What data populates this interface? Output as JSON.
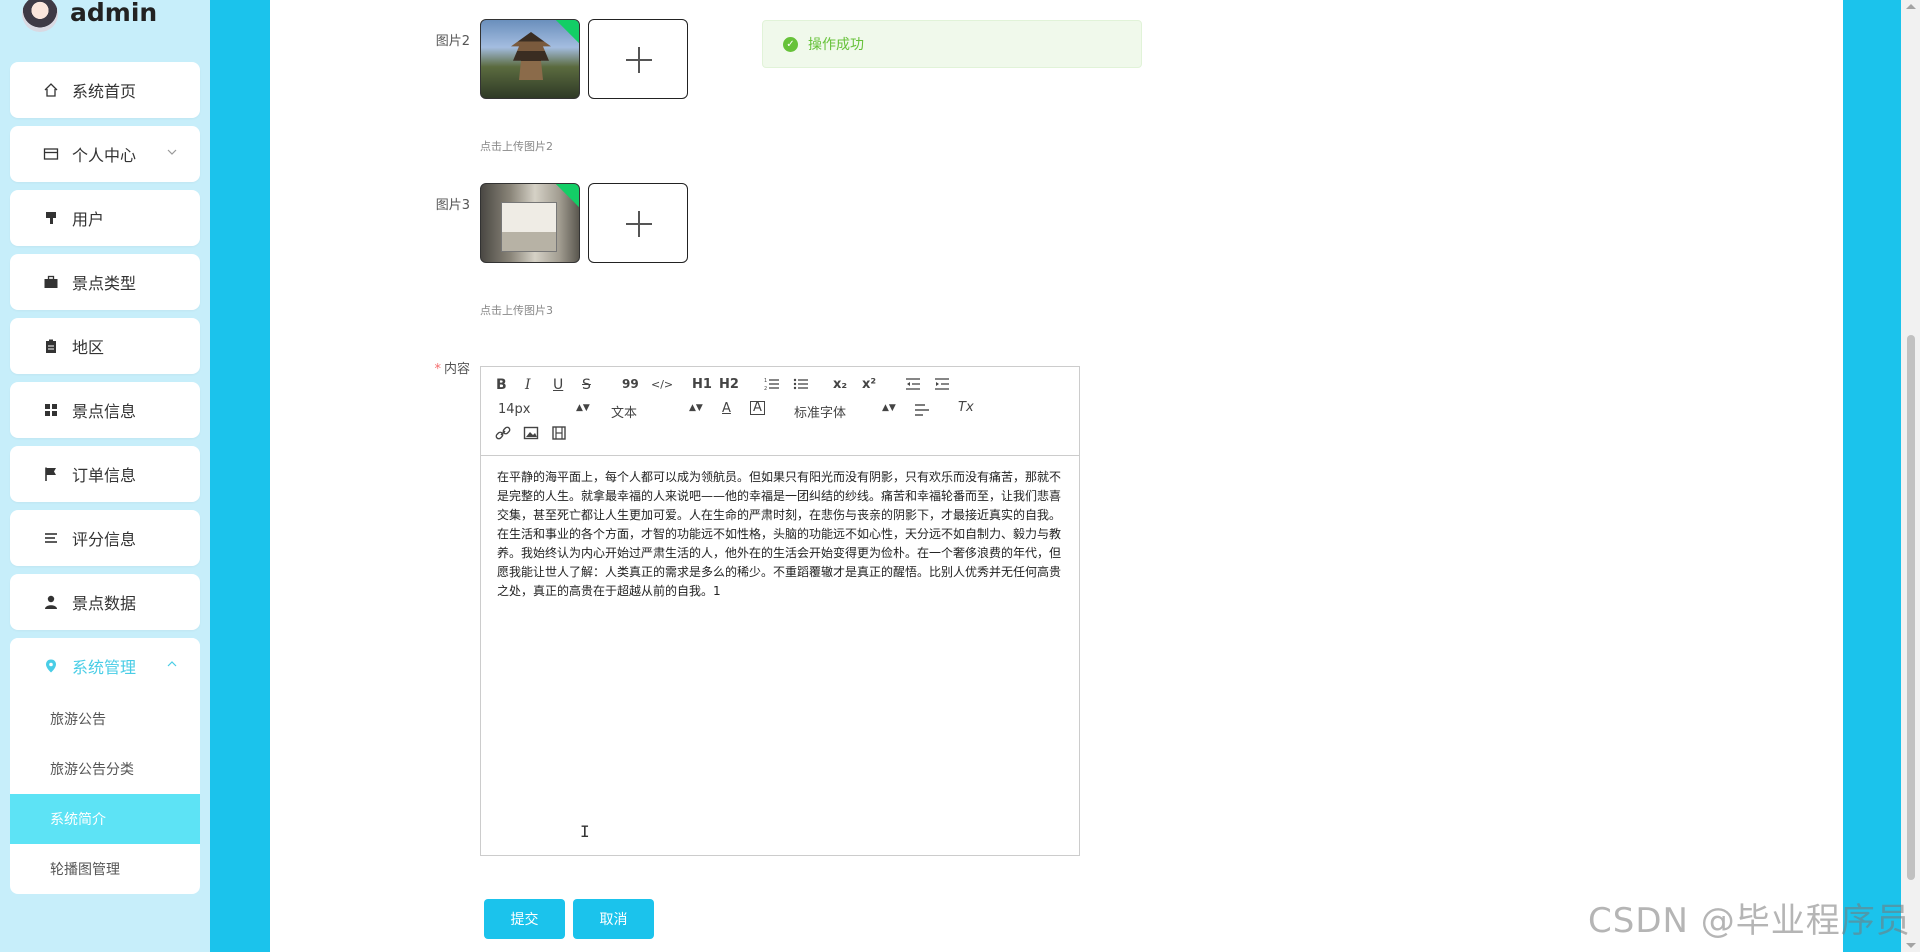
{
  "user": {
    "name": "admin"
  },
  "sidebar": {
    "items": [
      {
        "label": "系统首页",
        "icon": "home-icon"
      },
      {
        "label": "个人中心",
        "icon": "card-icon",
        "chevron": "down"
      },
      {
        "label": "用户",
        "icon": "brush-icon"
      },
      {
        "label": "景点类型",
        "icon": "briefcase-icon"
      },
      {
        "label": "地区",
        "icon": "clipboard-icon"
      },
      {
        "label": "景点信息",
        "icon": "grid-icon"
      },
      {
        "label": "订单信息",
        "icon": "flag-icon"
      },
      {
        "label": "评分信息",
        "icon": "list-icon"
      },
      {
        "label": "景点数据",
        "icon": "person-icon"
      }
    ],
    "group": {
      "label": "系统管理",
      "icon": "location-pin-icon",
      "chevron": "up",
      "subitems": [
        {
          "label": "旅游公告",
          "active": false
        },
        {
          "label": "旅游公告分类",
          "active": false
        },
        {
          "label": "系统简介",
          "active": true
        },
        {
          "label": "轮播图管理",
          "active": false
        }
      ]
    }
  },
  "form": {
    "image2": {
      "label": "图片2",
      "hint": "点击上传图片2"
    },
    "image3": {
      "label": "图片3",
      "hint": "点击上传图片3"
    },
    "content": {
      "required_mark": "*",
      "label": "内容",
      "toolbar": {
        "bold": "B",
        "italic": "I",
        "underline": "U",
        "strike": "S",
        "quote": "99",
        "code": "</>",
        "h1": "H1",
        "h2": "H2",
        "sub": "x₂",
        "sup": "x²",
        "size": "14px",
        "paragraph": "文本",
        "font": "标准字体",
        "font_color": "A",
        "bg_color": "A",
        "clear": "Tx"
      },
      "text": "在平静的海平面上，每个人都可以成为领航员。但如果只有阳光而没有阴影，只有欢乐而没有痛苦，那就不是完整的人生。就拿最幸福的人来说吧——他的幸福是一团纠结的纱线。痛苦和幸福轮番而至，让我们悲喜交集，甚至死亡都让人生更加可爱。人在生命的严肃时刻，在悲伤与丧亲的阴影下，才最接近真实的自我。在生活和事业的各个方面，才智的功能远不如性格，头脑的功能远不如心性，天分远不如自制力、毅力与教养。我始终认为内心开始过严肃生活的人，他外在的生活会开始变得更为俭朴。在一个奢侈浪费的年代，但愿我能让世人了解：人类真正的需求是多么的稀少。不重蹈覆辙才是真正的醒悟。比别人优秀并无任何高贵之处，真正的高贵在于超越从前的自我。1"
    }
  },
  "toast": {
    "message": "操作成功"
  },
  "buttons": {
    "submit": "提交",
    "cancel": "取消"
  },
  "watermark": "CSDN @毕业程序员",
  "colors": {
    "accent": "#1bc3ec",
    "sidebar_bg": "#c7eefa",
    "active_sub": "#5de3f5",
    "success": "#67c23a"
  }
}
